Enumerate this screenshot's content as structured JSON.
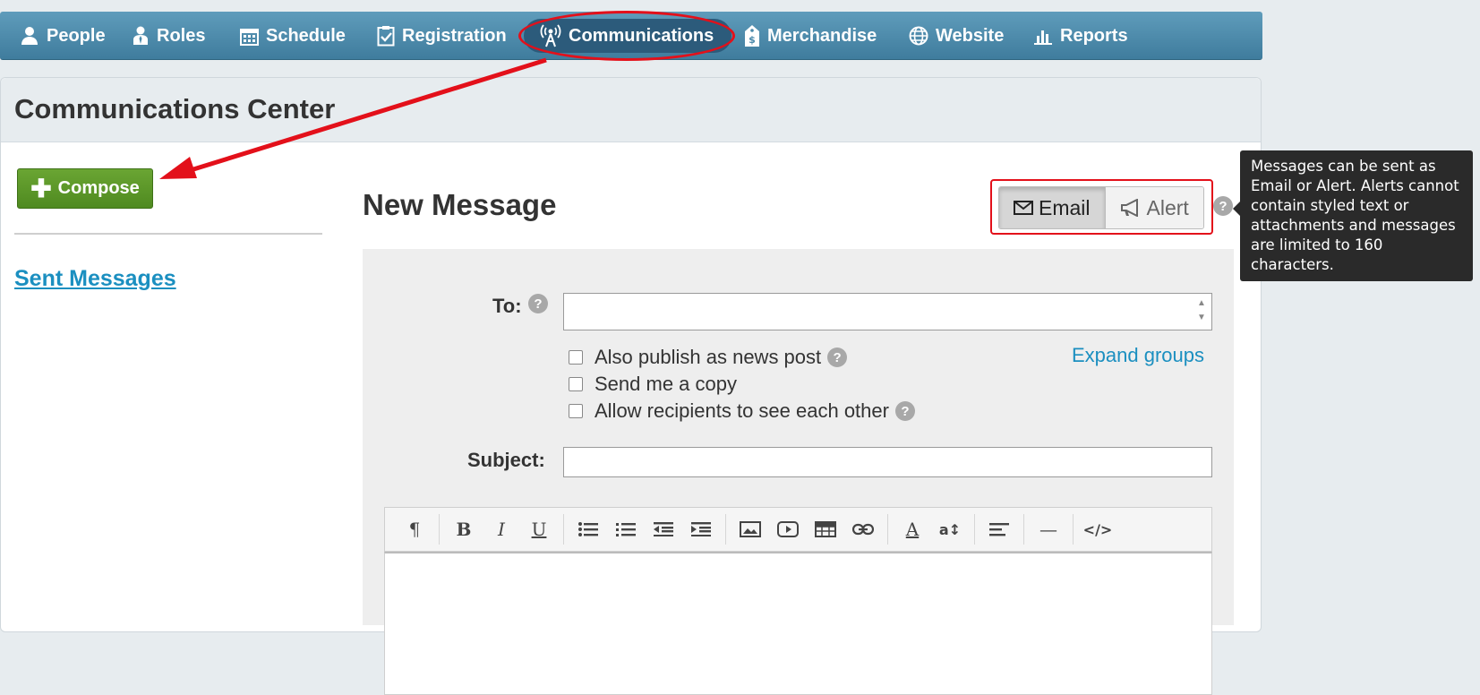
{
  "nav": {
    "items": [
      {
        "label": "People",
        "icon": "person-icon"
      },
      {
        "label": "Roles",
        "icon": "roles-icon"
      },
      {
        "label": "Schedule",
        "icon": "calendar-icon"
      },
      {
        "label": "Registration",
        "icon": "clipboard-icon"
      },
      {
        "label": "Communications",
        "icon": "broadcast-icon",
        "active": true
      },
      {
        "label": "Merchandise",
        "icon": "price-tag-icon"
      },
      {
        "label": "Website",
        "icon": "globe-icon"
      },
      {
        "label": "Reports",
        "icon": "bar-chart-icon"
      }
    ]
  },
  "page": {
    "title": "Communications Center"
  },
  "sidebar": {
    "compose_label": "Compose",
    "sent_messages_label": "Sent Messages"
  },
  "message": {
    "title": "New Message",
    "type_toggle": {
      "email_label": "Email",
      "alert_label": "Alert",
      "selected": "Email"
    },
    "help_glyph": "?",
    "tooltip": "Messages can be sent as Email or Alert. Alerts cannot contain styled text or attachments and messages are limited to 160 characters.",
    "to_label": "To:",
    "to_value": "",
    "options": [
      {
        "label": "Also publish as news post",
        "checked": false,
        "help": true
      },
      {
        "label": "Send me a copy",
        "checked": false,
        "help": false
      },
      {
        "label": "Allow recipients to see each other",
        "checked": false,
        "help": true
      }
    ],
    "expand_groups_label": "Expand groups",
    "subject_label": "Subject:",
    "subject_value": ""
  },
  "editor_toolbar": {
    "groups": [
      [
        {
          "name": "paragraph-format-icon",
          "glyph": "¶"
        }
      ],
      [
        {
          "name": "bold-icon",
          "glyph": "B"
        },
        {
          "name": "italic-icon",
          "glyph": "I"
        },
        {
          "name": "underline-icon",
          "glyph": "U"
        }
      ],
      [
        {
          "name": "bulleted-list-icon",
          "glyph": "≔"
        },
        {
          "name": "numbered-list-icon",
          "glyph": "≔"
        },
        {
          "name": "outdent-icon",
          "glyph": "⇤"
        },
        {
          "name": "indent-icon",
          "glyph": "⇥"
        }
      ],
      [
        {
          "name": "insert-image-icon",
          "glyph": "▣"
        },
        {
          "name": "insert-video-icon",
          "glyph": "▶"
        },
        {
          "name": "insert-table-icon",
          "glyph": "▦"
        },
        {
          "name": "insert-link-icon",
          "glyph": "∞"
        }
      ],
      [
        {
          "name": "font-color-icon",
          "glyph": "A"
        },
        {
          "name": "font-size-icon",
          "glyph": "a↕"
        }
      ],
      [
        {
          "name": "align-icon",
          "glyph": "≡"
        }
      ],
      [
        {
          "name": "horizontal-rule-icon",
          "glyph": "—"
        }
      ],
      [
        {
          "name": "code-view-icon",
          "glyph": "</>"
        }
      ]
    ]
  },
  "colors": {
    "nav_bg": "#4a89aa",
    "active_nav": "#2c5b7b",
    "compose_green": "#5a9628",
    "link_blue": "#1b8fc0",
    "annotation_red": "#e3101a"
  }
}
